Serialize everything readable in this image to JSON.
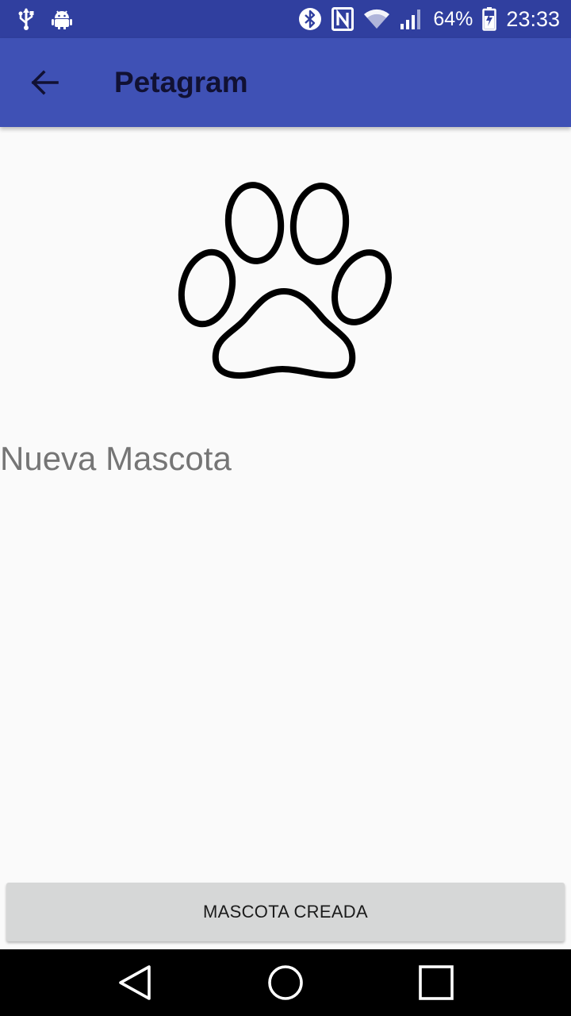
{
  "status_bar": {
    "battery_text": "64%",
    "time": "23:33",
    "icons": [
      "usb-icon",
      "android-debug-icon",
      "bluetooth-icon",
      "nfc-icon",
      "wifi-icon",
      "signal-icon",
      "battery-charging-icon"
    ]
  },
  "app_bar": {
    "title": "Petagram",
    "back_icon": "arrow-back-icon"
  },
  "content": {
    "image_icon": "paw-icon",
    "pet_name": "Nueva Mascota"
  },
  "actions": {
    "create_button_label": "MASCOTA CREADA"
  },
  "nav_bar": {
    "icons": [
      "back-triangle-icon",
      "home-circle-icon",
      "recents-square-icon"
    ]
  },
  "colors": {
    "status_bar": "#303f9f",
    "app_bar": "#3f51b5",
    "background": "#fafafa",
    "button": "#d6d7d7"
  }
}
